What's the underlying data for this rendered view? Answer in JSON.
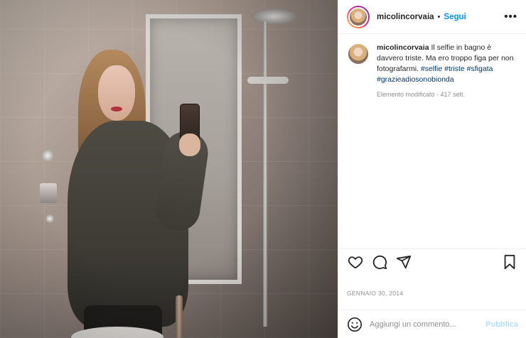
{
  "post": {
    "username": "micolincorvaia",
    "follow_label": "Segui",
    "separator": "•",
    "more_label": "•••",
    "caption_text": "Il selfie in bagno è davvero triste. Ma ero troppo figa per non fotografarmi.",
    "hashtags": [
      "#selfie",
      "#triste",
      "#sfigata",
      "#grazieadiosonobionda"
    ],
    "edited_label": "Elemento modificato · 417 sett.",
    "date": "GENNAIO 30, 2014"
  },
  "comment": {
    "placeholder": "Aggiungi un commento...",
    "publish_label": "Pubblica"
  },
  "icons": {
    "like": "heart-icon",
    "comment": "comment-icon",
    "share": "share-icon",
    "save": "bookmark-icon",
    "emoji": "emoji-icon",
    "more": "more-icon"
  },
  "colors": {
    "accent": "#0095f6",
    "hashtag": "#00376b",
    "muted": "#8e8e8e",
    "publish_disabled": "#b2dffc"
  }
}
